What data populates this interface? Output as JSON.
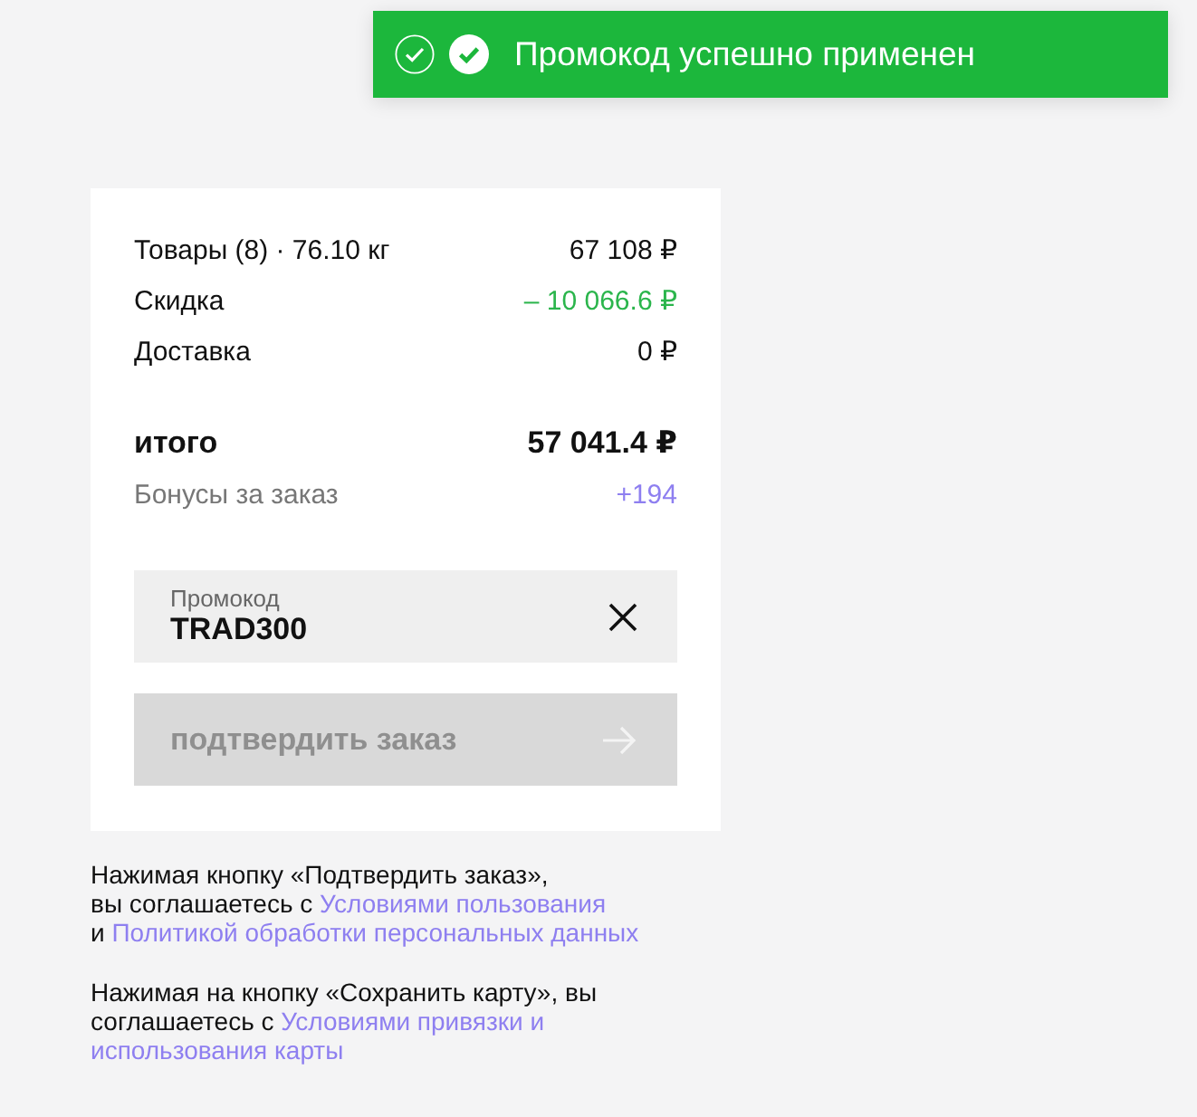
{
  "toast": {
    "text": "Промокод успешно применен"
  },
  "summary": {
    "lines": [
      {
        "kind": "regular",
        "label": "Товары (8) · 76.10 кг",
        "value": "67 108 ₽"
      },
      {
        "kind": "discount",
        "label": "Скидка",
        "value": "– 10 066.6 ₽"
      },
      {
        "kind": "regular",
        "label": "Доставка",
        "value": "0 ₽"
      }
    ],
    "total": {
      "label": "итого",
      "value": "57 041.4 ₽"
    },
    "bonus": {
      "label": "Бонусы за заказ",
      "value": "+194"
    }
  },
  "promo": {
    "label": "Промокод",
    "value": "TRAD300"
  },
  "confirm_button": {
    "label": "подтвердить заказ",
    "disabled": true
  },
  "legal": [
    {
      "lines": [
        [
          {
            "kind": "text",
            "text": "Нажимая кнопку «Подтвердить заказ»,"
          }
        ],
        [
          {
            "kind": "text",
            "text": "вы соглашаетесь с"
          },
          {
            "kind": "link",
            "text": "Условиями пользования"
          }
        ],
        [
          {
            "kind": "text",
            "text": "и"
          },
          {
            "kind": "link",
            "text": "Политикой обработки персональных данных"
          }
        ]
      ]
    },
    {
      "lines": [
        [
          {
            "kind": "text",
            "text": "Нажимая на кнопку «Сохранить карту», вы"
          }
        ],
        [
          {
            "kind": "text",
            "text": "соглашаетесь с"
          },
          {
            "kind": "link",
            "text": "Условиями привязки и"
          }
        ],
        [
          {
            "kind": "link",
            "text": "использования карты"
          }
        ]
      ]
    }
  ]
}
